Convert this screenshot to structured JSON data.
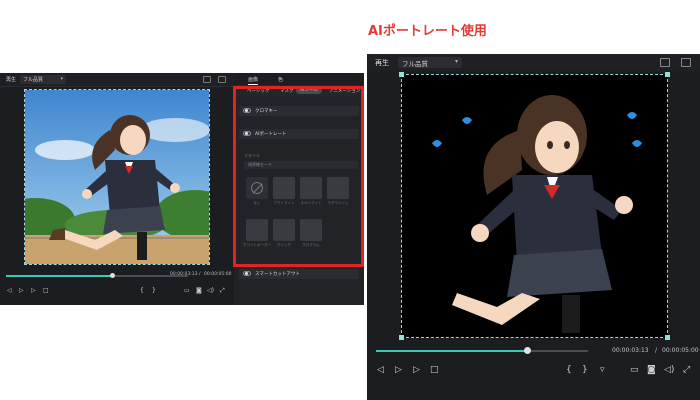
{
  "title": "AIポートレート使用",
  "left_player": {
    "label": "再生",
    "quality": "フル品質",
    "time_current": "00:00:03:13",
    "time_sep": "/",
    "time_total": "00:00:05:00",
    "progress": 0.57
  },
  "panel": {
    "tabs": [
      "画像",
      "色"
    ],
    "subtabs": [
      "ベーシック",
      "マスク",
      "AIツール",
      "アニメーション"
    ],
    "rows": {
      "chroma": "クロマキー",
      "ai_portrait": "AIポートレート",
      "smart_cutout": "スマートカットアウト"
    },
    "style_caption": "スタイル",
    "field_placeholder": "境界線モード",
    "presets": [
      "なし",
      "アウトライン",
      "ネオンライト",
      "ラグランジュ",
      "ホワイトボーダー",
      "グリッチ",
      "ホログラム"
    ]
  },
  "right_player": {
    "label": "再生",
    "quality": "フル品質",
    "time_current": "00:00:03:13",
    "time_sep": "/",
    "time_total": "00:00:05:00",
    "progress": 0.72
  },
  "icons": [
    "toggle-icon",
    "play-icon",
    "stop-icon",
    "prev-frame-icon",
    "next-frame-icon",
    "fullscreen-icon",
    "snapshot-icon",
    "volume-icon",
    "monitor-icon",
    "image-icon",
    "grid-icon"
  ],
  "colors": {
    "accent": "#41c7b5",
    "highlight": "#e02424",
    "title": "#e53935"
  }
}
